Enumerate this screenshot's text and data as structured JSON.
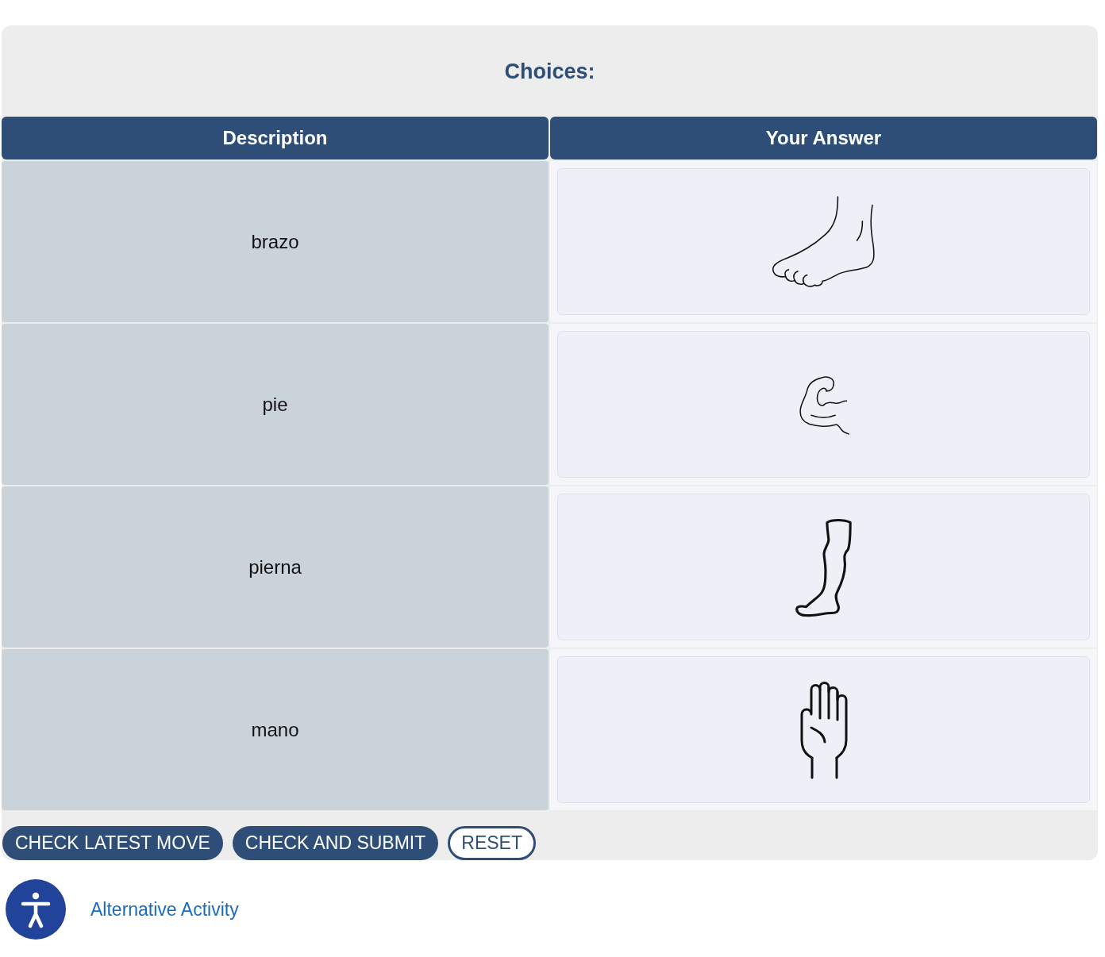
{
  "title": "Choices:",
  "table": {
    "columns": [
      "Description",
      "Your Answer"
    ],
    "rows": [
      {
        "description": "brazo",
        "answer": {
          "kind": "foot"
        }
      },
      {
        "description": "pie",
        "answer": {
          "kind": "arm"
        }
      },
      {
        "description": "pierna",
        "answer": {
          "kind": "leg"
        }
      },
      {
        "description": "mano",
        "answer": {
          "kind": "hand"
        }
      }
    ]
  },
  "buttons": [
    {
      "label": "CHECK LATEST MOVE",
      "kind": "filled"
    },
    {
      "label": "CHECK AND SUBMIT",
      "kind": "filled"
    },
    {
      "label": "RESET",
      "kind": "outline"
    }
  ],
  "alternative": {
    "label": "Alternative Activity"
  }
}
